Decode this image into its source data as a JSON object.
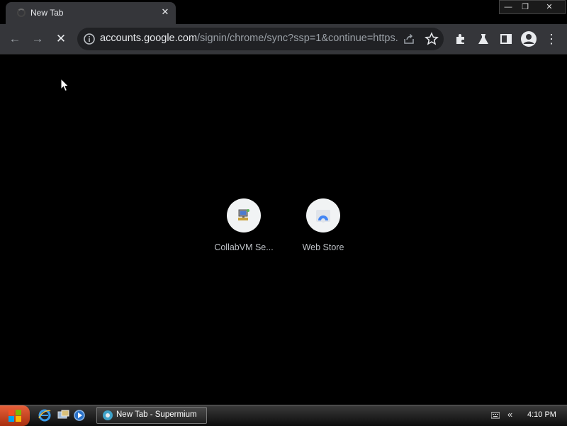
{
  "browser": {
    "tab": {
      "title": "New Tab",
      "close_glyph": "✕"
    },
    "window_controls": {
      "minimize": "—",
      "restore": "❐",
      "close": "✕"
    },
    "toolbar": {
      "back_glyph": "←",
      "forward_glyph": "→",
      "stop_glyph": "✕",
      "menu_glyph": "⋮"
    },
    "omnibox": {
      "host": "accounts.google.com",
      "path": "/signin/chrome/sync?ssp=1&continue=https..."
    },
    "toolbar_icons": [
      "info-icon",
      "share-icon",
      "star-icon",
      "extensions-icon",
      "labs-icon",
      "side-panel-icon",
      "profile-icon",
      "menu-icon"
    ]
  },
  "new_tab": {
    "shortcuts": [
      {
        "label": "CollabVM Se...",
        "icon": "collabvm-icon"
      },
      {
        "label": "Web Store",
        "icon": "web-store-icon"
      }
    ]
  },
  "taskbar": {
    "task_label": "New Tab - Supermium",
    "tray_chevron": "«",
    "clock": "4:10 PM"
  },
  "colors": {
    "tab_bg": "#35363a",
    "omnibox_bg": "#202124",
    "page_bg": "#000000",
    "start_orange": "#d9532b"
  }
}
